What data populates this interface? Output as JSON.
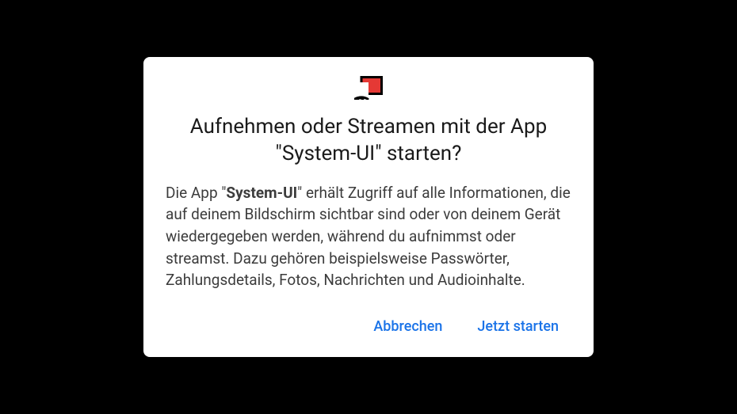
{
  "dialog": {
    "title": "Aufnehmen oder Streamen mit der App \"System-UI\" starten?",
    "body_prefix": "Die App \"",
    "body_app": "System-UI",
    "body_suffix": "\" erhält Zugriff auf alle Informationen, die auf deinem Bildschirm sichtbar sind oder von deinem Gerät wiedergegeben werden, während du aufnimmst oder streamst. Dazu gehören beispielsweise Passwörter, Zahlungsdetails, Fotos, Nachrichten und Audioinhalte.",
    "buttons": {
      "cancel": "Abbrechen",
      "start": "Jetzt starten"
    }
  }
}
